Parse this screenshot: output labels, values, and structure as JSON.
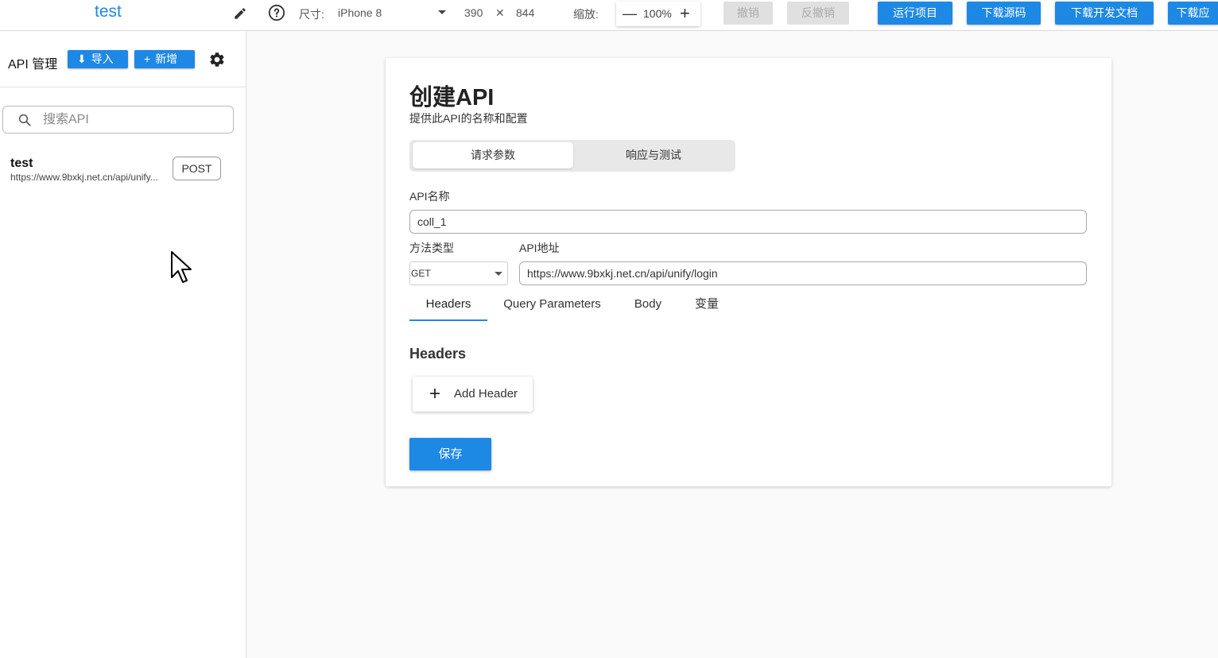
{
  "topbar": {
    "project_title": "test",
    "size_label": "尺寸:",
    "device": "iPhone 8",
    "width": "390",
    "times": "✕",
    "height": "844",
    "zoom_label": "缩放:",
    "zoom_value": "100%",
    "undo": "撤销",
    "redo": "反撤销",
    "run_project": "运行项目",
    "download_source": "下载源码",
    "download_docs": "下载开发文档",
    "download_app": "下载应"
  },
  "sidebar": {
    "title": "API 管理",
    "import_label": "导入",
    "add_label": "新增",
    "search_placeholder": "搜索API",
    "items": [
      {
        "name": "test",
        "url": "https://www.9bxkj.net.cn/api/unify...",
        "method": "POST"
      }
    ]
  },
  "main": {
    "title": "创建API",
    "subtitle": "提供此API的名称和配置",
    "seg_tabs": [
      "请求参数",
      "响应与测试"
    ],
    "api_name_label": "API名称",
    "api_name_value": "coll_1",
    "method_label": "方法类型",
    "method_value": "GET",
    "api_url_label": "API地址",
    "api_url_value": "https://www.9bxkj.net.cn/api/unify/login",
    "tabs": [
      "Headers",
      "Query Parameters",
      "Body",
      "变量"
    ],
    "section_title": "Headers",
    "add_header": "Add Header",
    "save": "保存"
  },
  "colors": {
    "primary": "#1e88e5"
  },
  "icons": [
    "edit-icon",
    "help-icon",
    "chevron-down-icon",
    "minus-icon",
    "plus-icon",
    "download-icon",
    "gear-icon",
    "search-icon",
    "cursor-icon"
  ]
}
